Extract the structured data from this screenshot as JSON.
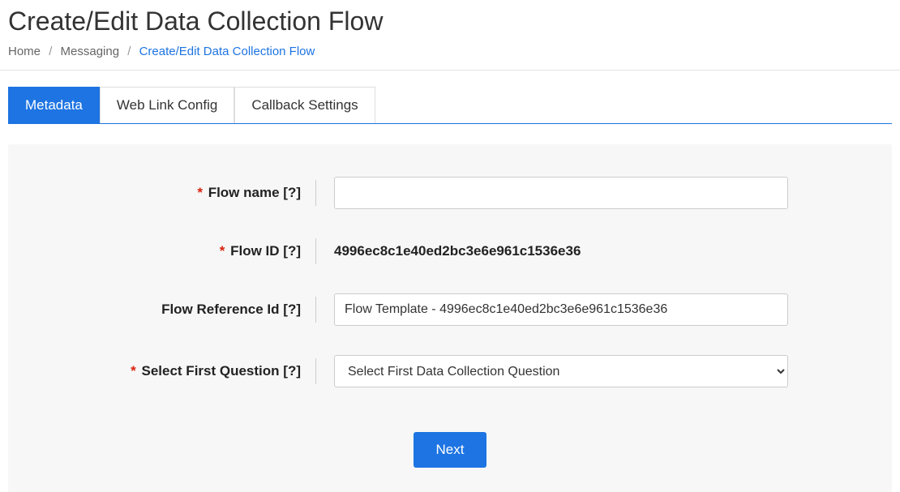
{
  "header": {
    "title": "Create/Edit Data Collection Flow"
  },
  "breadcrumb": {
    "home": "Home",
    "messaging": "Messaging",
    "current": "Create/Edit Data Collection Flow"
  },
  "tabs": {
    "metadata": "Metadata",
    "web_link": "Web Link Config",
    "callback": "Callback Settings"
  },
  "form": {
    "required_marker": "*",
    "help_marker": "[?]",
    "flow_name": {
      "label": "Flow name",
      "value": ""
    },
    "flow_id": {
      "label": "Flow ID",
      "value": "4996ec8c1e40ed2bc3e6e961c1536e36"
    },
    "flow_reference_id": {
      "label": "Flow Reference Id",
      "value": "Flow Template - 4996ec8c1e40ed2bc3e6e961c1536e36"
    },
    "first_question": {
      "label": "Select First Question",
      "selected": "Select First Data Collection Question"
    }
  },
  "buttons": {
    "next": "Next"
  }
}
